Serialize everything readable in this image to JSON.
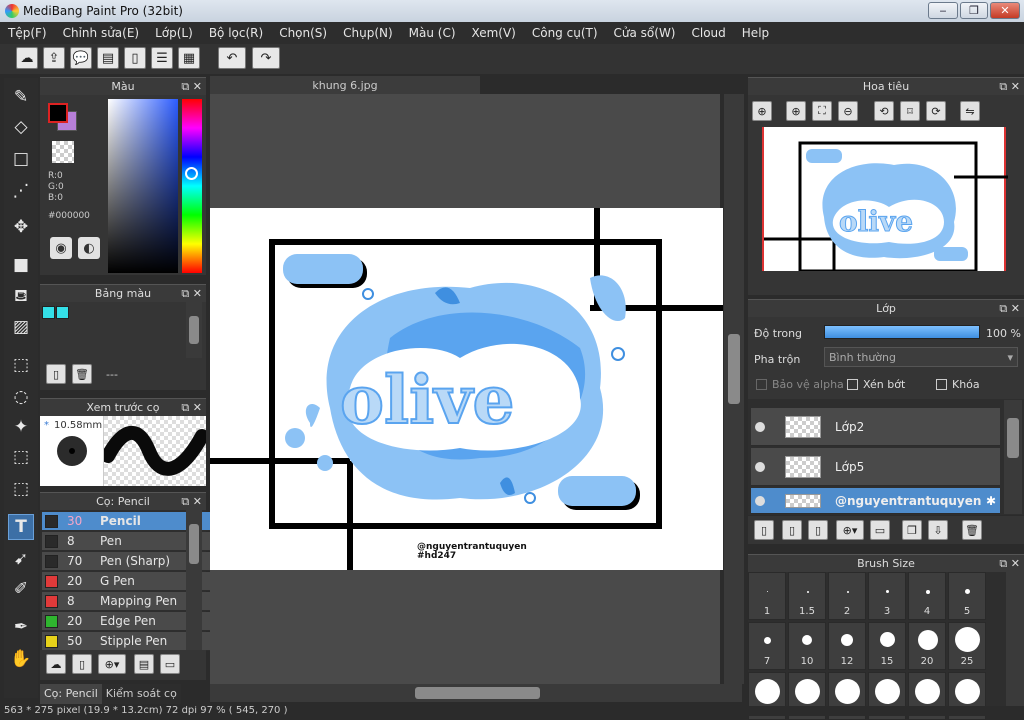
{
  "window": {
    "title": "MediBang Paint Pro (32bit)"
  },
  "menu": [
    "Tệp(F)",
    "Chỉnh sửa(E)",
    "Lớp(L)",
    "Bộ lọc(R)",
    "Chọn(S)",
    "Chụp(N)",
    "Màu (C)",
    "Xem(V)",
    "Công cụ(T)",
    "Cửa sổ(W)",
    "Cloud",
    "Help"
  ],
  "panels": {
    "color": {
      "title": "Màu",
      "r": "R:0",
      "g": "G:0",
      "b": "B:0",
      "hex": "#000000",
      "fg_color": "#000000",
      "bg_color": "#b77fd8"
    },
    "palette": {
      "title": "Bảng màu",
      "swatch_color": "#34e0e8",
      "footer": "---"
    },
    "brush_preview": {
      "title": "Xem trước cọ",
      "size": "10.58mm",
      "asterisk": "*"
    },
    "brush": {
      "title": "Cọ: Pencil",
      "items": [
        {
          "size": "30",
          "name": "Pencil",
          "color": "#2a2a2a",
          "selected": true
        },
        {
          "size": "8",
          "name": "Pen",
          "color": "#2a2a2a"
        },
        {
          "size": "70",
          "name": "Pen (Sharp)",
          "color": "#2a2a2a"
        },
        {
          "size": "20",
          "name": "G Pen",
          "color": "#e03a3a"
        },
        {
          "size": "8",
          "name": "Mapping Pen",
          "color": "#e03a3a"
        },
        {
          "size": "20",
          "name": "Edge Pen",
          "color": "#2fb52f"
        },
        {
          "size": "50",
          "name": "Stipple Pen",
          "color": "#e8d21a"
        }
      ]
    },
    "bottom_tabs": [
      "Cọ: Pencil",
      "Kiểm soát cọ"
    ],
    "navigator": {
      "title": "Hoa tiêu"
    },
    "layer": {
      "title": "Lớp",
      "opacity_label": "Độ trong",
      "opacity_value": "100 %",
      "opacity": 1.0,
      "blend_label": "Pha trộn",
      "blend_value": "Bình thường",
      "protect_alpha": "Bảo vệ alpha",
      "clipping": "Xén bớt",
      "lock": "Khóa",
      "items": [
        {
          "name": "Lớp2"
        },
        {
          "name": "Lớp5"
        },
        {
          "name": "@nguyentrantuquyen",
          "selected": true
        }
      ]
    },
    "brush_size": {
      "title": "Brush Size",
      "sizes": [
        "1",
        "1.5",
        "2",
        "3",
        "4",
        "5",
        "7",
        "10",
        "12",
        "15",
        "20",
        "25"
      ]
    }
  },
  "document": {
    "tab": "khung 6.jpg",
    "title_text": "olive",
    "credit": "@nguyentrantuquyen",
    "tag": "#hd247",
    "accent": "#3f8fe0"
  },
  "statusbar": "563 * 275 pixel   (19.9 * 13.2cm)   72 dpi   97 %   ( 545, 270 )"
}
